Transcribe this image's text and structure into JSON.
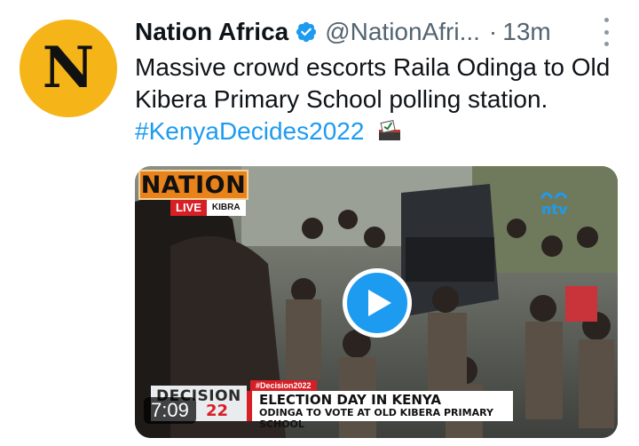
{
  "account": {
    "avatar_letter": "N",
    "avatar_color": "#f5b417",
    "name": "Nation Africa",
    "handle": "@NationAfri...",
    "separator": "·",
    "time_ago": "13m",
    "verified": true
  },
  "tweet": {
    "text": "Massive crowd escorts Raila Odinga to Old Kibera Primary School polling station.",
    "hashtag": "#KenyaDecides2022",
    "emoji": "ballot-box-icon"
  },
  "media": {
    "broadcaster_logo": "NATION",
    "live_label": "LIVE",
    "location_label": "KIBRA",
    "channel_logo": "ntv",
    "ticker_brand": "DECISION",
    "ticker_year": "22",
    "ticker_tag": "#Decision2022",
    "headline": "ELECTION DAY IN KENYA",
    "subheadline": "ODINGA TO VOTE AT OLD KIBERA PRIMARY SCHOOL",
    "duration": "7:09",
    "play_icon": "play-icon"
  },
  "colors": {
    "link": "#1d9bf0",
    "secondary_text": "#536471",
    "accent_red": "#d71f26",
    "nation_orange": "#e8821a"
  }
}
